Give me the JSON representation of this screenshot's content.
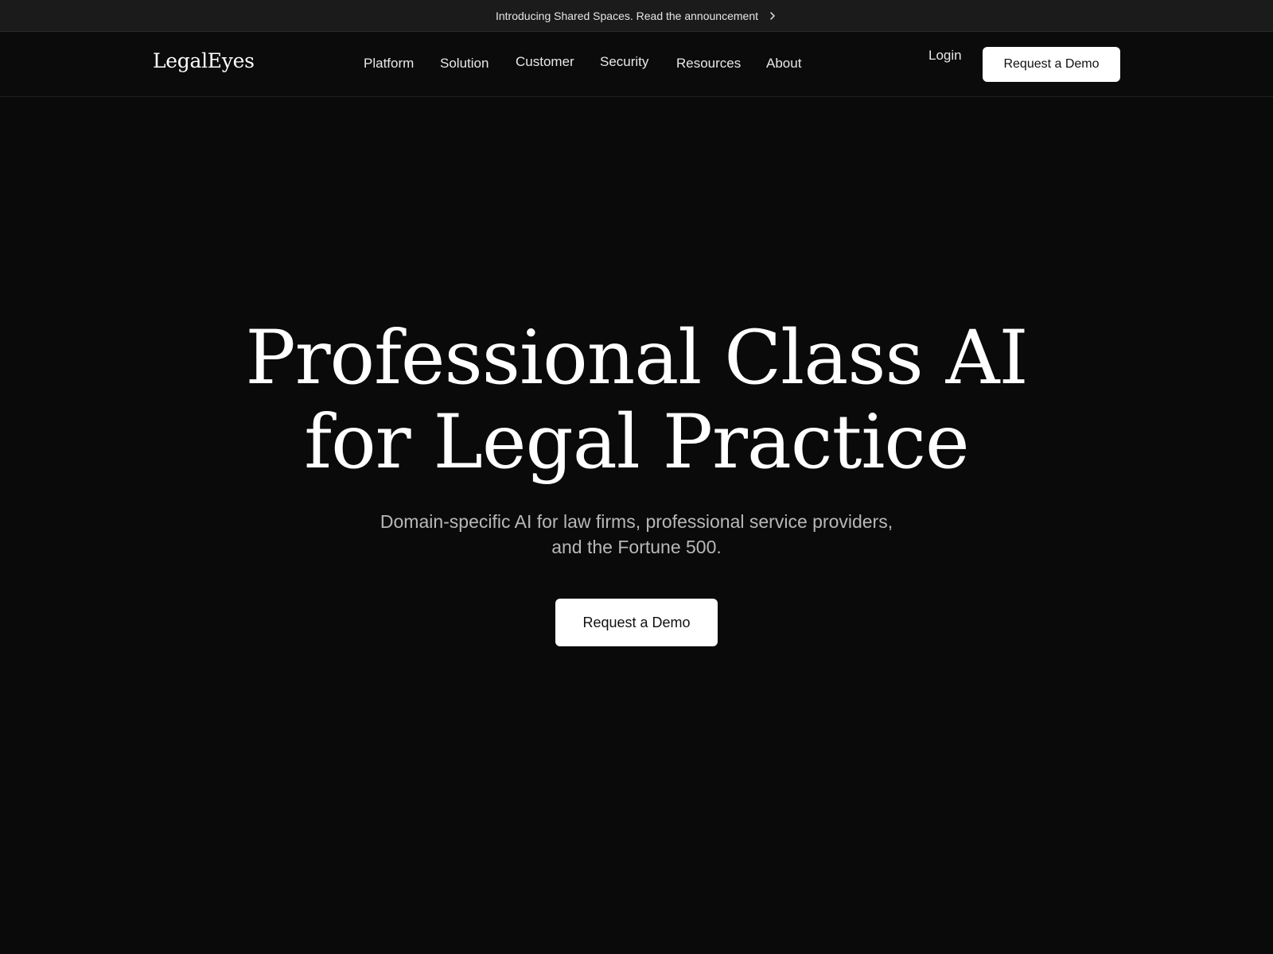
{
  "announcement": {
    "text": "Introducing Shared Spaces. Read the announcement",
    "icon": "chevron-right-icon"
  },
  "header": {
    "logo": "LegalEyes",
    "nav": [
      {
        "label": "Platform"
      },
      {
        "label": "Solution"
      },
      {
        "label": "Customer"
      },
      {
        "label": "Security"
      },
      {
        "label": "Resources"
      },
      {
        "label": "About"
      }
    ],
    "login_label": "Login",
    "cta_label": "Request a Demo"
  },
  "hero": {
    "title_lines": [
      "Professional Class AI",
      "for Legal Practice"
    ],
    "subtitle_lines": [
      "Domain-specific AI for law firms, professional service providers,",
      "and the Fortune 500."
    ],
    "cta_label": "Request a Demo"
  },
  "colors": {
    "background": "#0a0a0a",
    "announcement_bar": "#1b1b1b",
    "button_bg": "#ffffff",
    "button_text": "#111111",
    "subtitle_text": "#b8b8b8"
  }
}
